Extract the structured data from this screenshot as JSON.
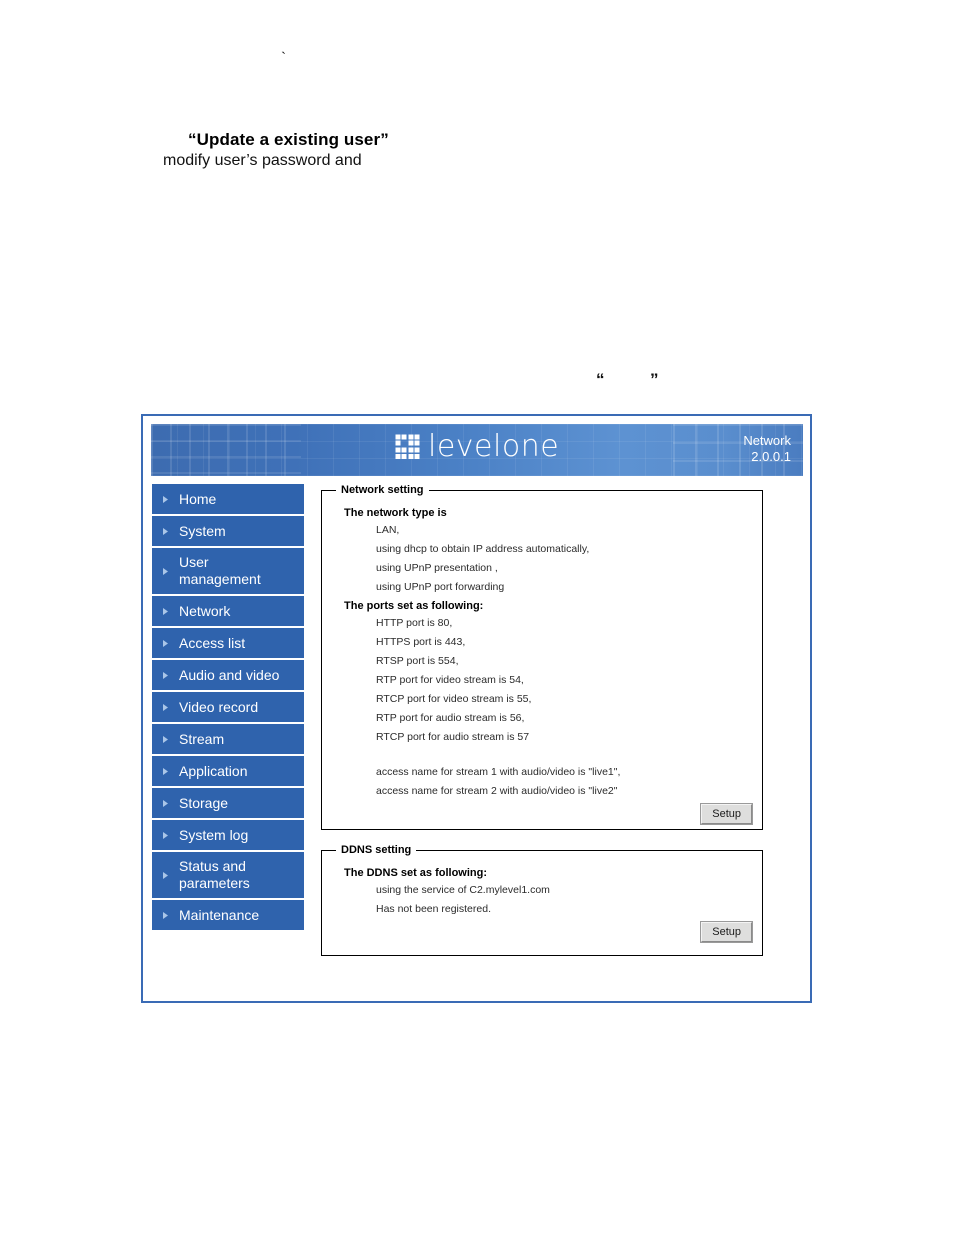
{
  "document": {
    "tick_mark": "`",
    "heading": "“Update a existing user”",
    "subtext": "modify user’s password and",
    "quote_open": "“",
    "quote_close": "”"
  },
  "app": {
    "banner": {
      "brand_name": "levelone",
      "brand_mark_icon": "levelone-grid-logo-icon",
      "page_title": "Network",
      "version": "2.0.0.1"
    },
    "sidebar": {
      "items": [
        {
          "label": "Home",
          "icon": "chevron-right-icon"
        },
        {
          "label": "System",
          "icon": "chevron-right-icon"
        },
        {
          "label": "User management",
          "icon": "chevron-right-icon"
        },
        {
          "label": "Network",
          "icon": "chevron-right-icon"
        },
        {
          "label": "Access list",
          "icon": "chevron-right-icon"
        },
        {
          "label": "Audio and video",
          "icon": "chevron-right-icon"
        },
        {
          "label": "Video record",
          "icon": "chevron-right-icon"
        },
        {
          "label": "Stream",
          "icon": "chevron-right-icon"
        },
        {
          "label": "Application",
          "icon": "chevron-right-icon"
        },
        {
          "label": "Storage",
          "icon": "chevron-right-icon"
        },
        {
          "label": "System log",
          "icon": "chevron-right-icon"
        },
        {
          "label": "Status and parameters",
          "icon": "chevron-right-icon"
        },
        {
          "label": "Maintenance",
          "icon": "chevron-right-icon"
        }
      ]
    },
    "network_panel": {
      "legend": "Network setting",
      "type_heading": "The network type is",
      "type_lines": [
        "LAN,",
        "using dhcp to obtain IP address automatically,",
        "using UPnP presentation ,",
        "using UPnP port forwarding"
      ],
      "ports_heading": "The ports set as following:",
      "port_lines": [
        "HTTP port is 80,",
        "HTTPS port is 443,",
        "RTSP port is 554,",
        "RTP port for video stream is 54,",
        "RTCP port for video stream is 55,",
        "RTP port for audio stream is 56,",
        "RTCP port for audio stream is 57"
      ],
      "access_lines": [
        "access name for stream 1 with audio/video is \"live1\",",
        "access name for stream 2 with audio/video is \"live2\""
      ],
      "setup_label": "Setup"
    },
    "ddns_panel": {
      "legend": "DDNS setting",
      "heading": "The DDNS set as following:",
      "lines": [
        "using the service of C2.mylevel1.com",
        "Has not been registered."
      ],
      "setup_label": "Setup"
    }
  },
  "colors": {
    "frame_border": "#3a6bb5",
    "banner_blue": "#4b81c6",
    "nav_blue": "#2f63ad",
    "button_grey": "#dededd"
  }
}
